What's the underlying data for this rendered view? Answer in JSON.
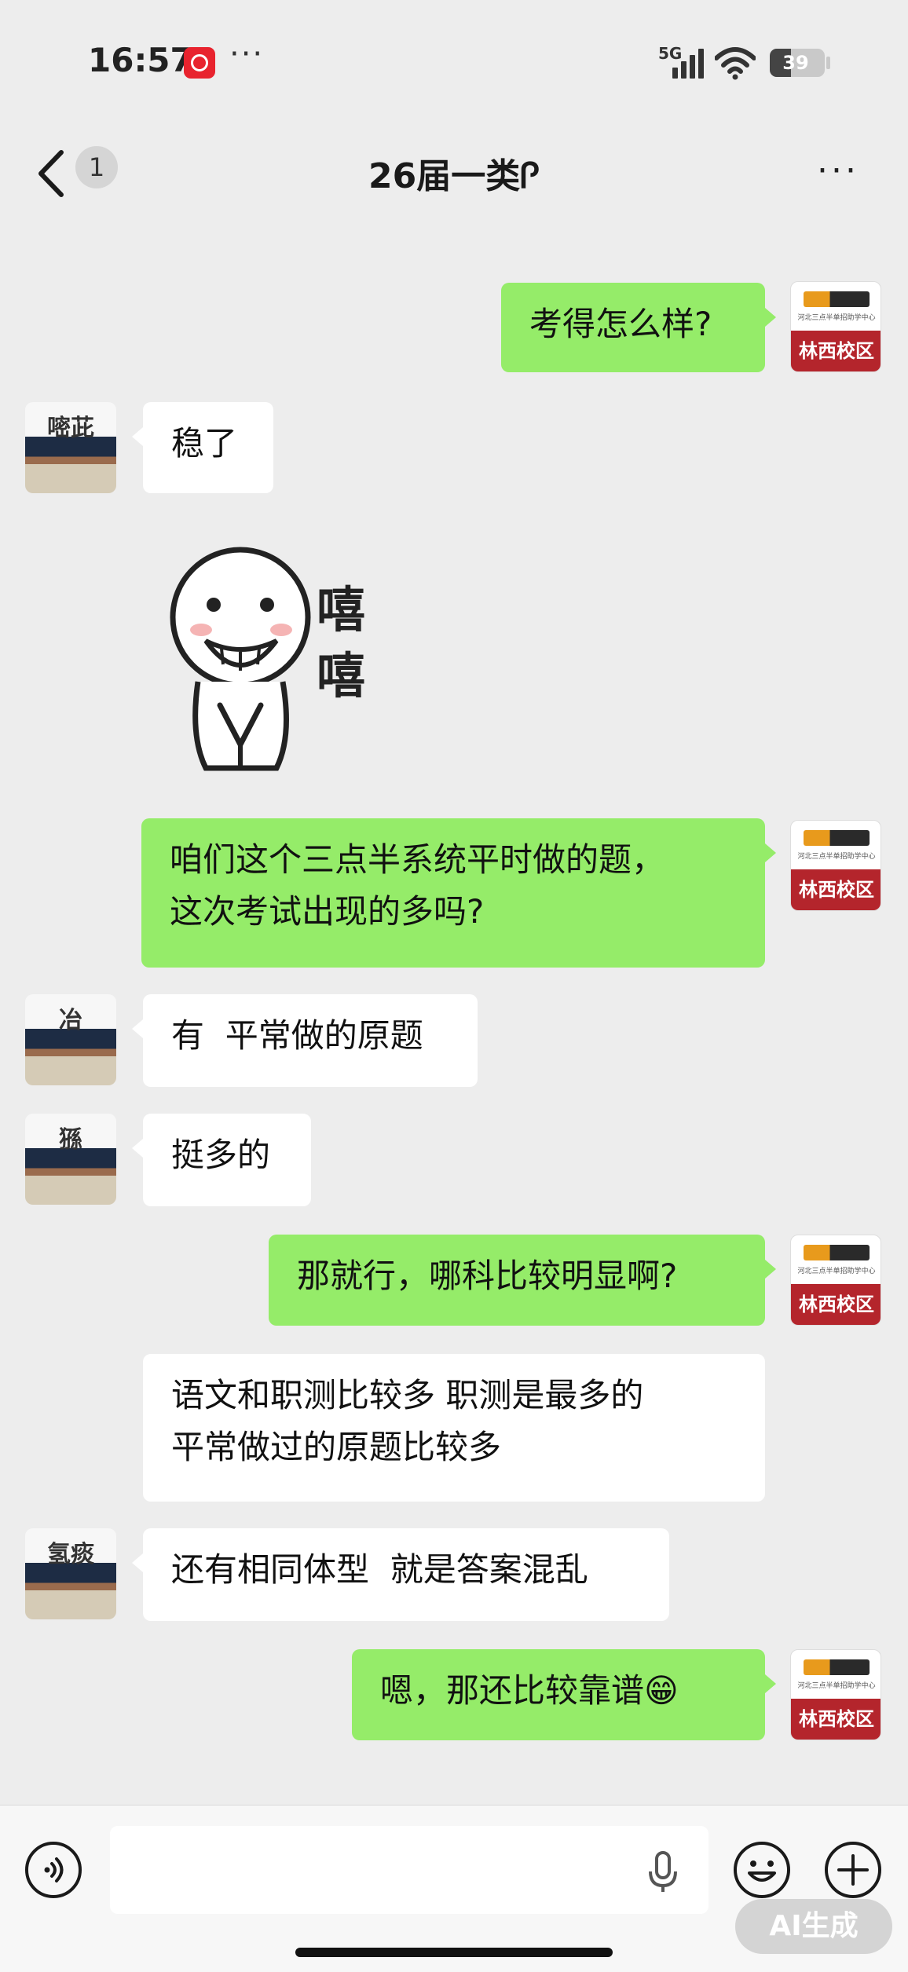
{
  "status_bar": {
    "time": "16:57",
    "dots": "···",
    "network": "5G",
    "battery_percent": 39,
    "battery_label": "39"
  },
  "header": {
    "unread_count": "1",
    "title": "26届一类Ꮅ",
    "more": "···"
  },
  "messages": [
    {
      "side": "right",
      "text": "考得怎么样?"
    },
    {
      "side": "left",
      "text": "稳了"
    },
    {
      "side": "left",
      "type": "sticker",
      "sticker_text": "嘻\n嘻"
    },
    {
      "side": "right",
      "text": "咱们这个三点半系统平时做的题，\n这次考试出现的多吗?"
    },
    {
      "side": "left",
      "text": "有  平常做的原题"
    },
    {
      "side": "left",
      "text": "挺多的"
    },
    {
      "side": "right",
      "text": "那就行，哪科比较明显啊?"
    },
    {
      "side": "left",
      "text": "语文和职测比较多 职测是最多的\n平常做过的原题比较多"
    },
    {
      "side": "left",
      "text": "还有相同体型  就是答案混乱"
    },
    {
      "side": "right",
      "text": "嗯，那还比较靠谱😁"
    }
  ],
  "avatars": {
    "right_banner": "林西校区",
    "right_sub": "河北三点半单招助学中心",
    "left_glyphs": [
      "嘧茈",
      "冶",
      "猻",
      "氢痰"
    ]
  },
  "bottom_bar": {
    "ai_label": "AI生成"
  },
  "colors": {
    "background": "#ededed",
    "own_bubble": "#95ec69",
    "other_bubble": "#ffffff",
    "avatar_banner": "#b4252c"
  }
}
